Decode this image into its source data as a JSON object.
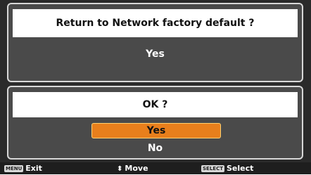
{
  "dialog1": {
    "title": "Return to Network factory default ?",
    "option_yes": "Yes"
  },
  "dialog2": {
    "title": "OK ?",
    "option_yes": "Yes",
    "option_no": "No",
    "selected": "Yes"
  },
  "hints": {
    "exit_key": "MENU",
    "exit_label": "Exit",
    "move_icon": "up-down-arrow-icon",
    "move_label": "Move",
    "select_key": "SELECT",
    "select_label": "Select"
  },
  "colors": {
    "highlight": "#e87f1c",
    "background": "#2a2a2a",
    "panel": "#4a4a4a"
  }
}
